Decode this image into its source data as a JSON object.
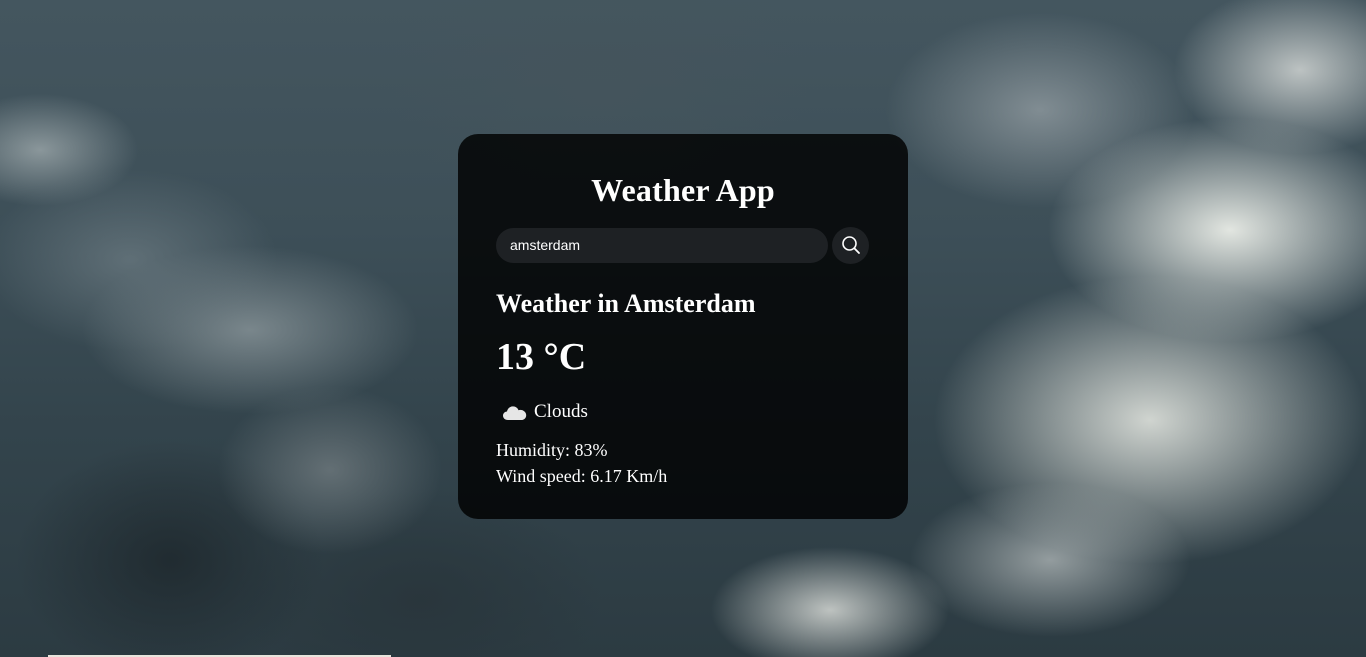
{
  "app": {
    "title": "Weather App"
  },
  "search": {
    "value": "amsterdam",
    "placeholder": "",
    "button_icon": "search-icon"
  },
  "weather": {
    "location": "Weather in Amsterdam",
    "temperature": "13 °C",
    "condition": "Clouds",
    "condition_icon": "cloud-icon",
    "humidity": "Humidity: 83%",
    "wind": "Wind speed: 6.17 Km/h"
  },
  "colors": {
    "card_background": "#000000",
    "input_background": "#1e2124",
    "text": "#ffffff"
  }
}
